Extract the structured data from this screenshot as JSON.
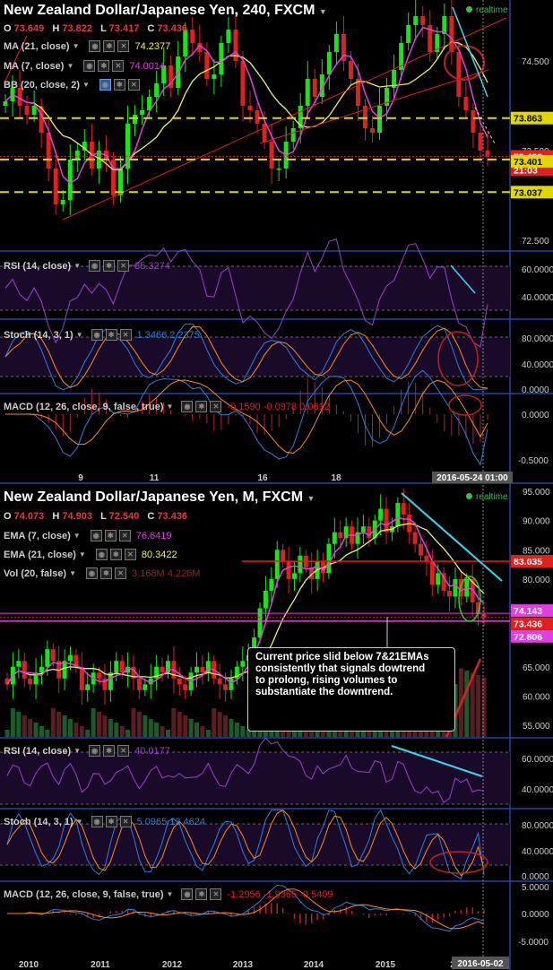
{
  "colors": {
    "bull": "#16e516",
    "bear": "#e01f1f",
    "ma21": "#f0f060",
    "ma7": "#e040e0",
    "bb": "#c8c850",
    "rsi": "#9b3fd0",
    "stoch_k": "#2a7fe0",
    "stoch_d": "#ff8a1c",
    "macd": "#2a7fe0",
    "signal": "#ff8a1c",
    "grid": "#222",
    "axis_sep": "#2244aa",
    "cyan": "#3ad7f0",
    "price_red": "#e01f1f",
    "dash_yellow": "#e0d800"
  },
  "realtime_label": "realtime",
  "top": {
    "title": "New Zealand Dollar/Japanese Yen, 240, FXCM",
    "ohlc": [
      {
        "k": "O",
        "v": "73.649"
      },
      {
        "k": "H",
        "v": "73.822"
      },
      {
        "k": "L",
        "v": "73.417"
      },
      {
        "k": "C",
        "v": "73.436"
      }
    ],
    "indicators": [
      {
        "label": "MA (21, close)",
        "value": "74.2377",
        "color": "#f0f060"
      },
      {
        "label": "MA (7, close)",
        "value": "74.0014",
        "color": "#e040e0"
      },
      {
        "label": "BB (20, close, 2)",
        "value": "",
        "color": "#c8c850"
      }
    ],
    "price_labels": [
      "74.500",
      "73.500",
      "72.500"
    ],
    "tags": [
      {
        "text": "73.863"
      },
      {
        "text": "73.436"
      },
      {
        "text": "21:03"
      },
      {
        "text": "73.401"
      },
      {
        "text": "73.037"
      }
    ],
    "rsi": {
      "label": "RSI (14, close)",
      "value": "35.3274",
      "ticks": [
        "60.0000",
        "40.0000"
      ]
    },
    "stoch": {
      "label": "Stoch (14, 3, 1)",
      "values": "1.3466 2.2375",
      "ticks": [
        "80.0000",
        "40.0000",
        "0.0000"
      ]
    },
    "macd": {
      "label": "MACD (12, 26, close, 9, false, true)",
      "values": "-0.1590 -0.0978 0.0612",
      "ticks": [
        "0.0000",
        "-0.5000"
      ]
    },
    "x_labels": [
      "9",
      "11",
      "16",
      "18"
    ],
    "x_current": "2016-05-24 01:00"
  },
  "bottom": {
    "title": "New Zealand Dollar/Japanese Yen, M, FXCM",
    "ohlc": [
      {
        "k": "O",
        "v": "74.073"
      },
      {
        "k": "H",
        "v": "74.903"
      },
      {
        "k": "L",
        "v": "72.540"
      },
      {
        "k": "C",
        "v": "73.436"
      }
    ],
    "indicators": [
      {
        "label": "EMA (7, close)",
        "value": "76.6419",
        "color": "#e040e0"
      },
      {
        "label": "EMA (21, close)",
        "value": "80.3422",
        "color": "#f0f060"
      },
      {
        "label": "Vol (20, false)",
        "value": "3.168M 4.226M",
        "color": "#8a2a2a"
      }
    ],
    "price_labels": [
      "95.000",
      "90.000",
      "85.000",
      "80.000",
      "75.000",
      "65.000",
      "60.000",
      "55.000"
    ],
    "tags": [
      {
        "text": "83.035"
      },
      {
        "text": "74.143"
      },
      {
        "text": "73.436"
      },
      {
        "text": "72.806"
      }
    ],
    "annotation": "Current price slid below 7&21EMAs consistently that signals dowtrend to prolong, rising volumes to substantiate the downtrend.",
    "rsi": {
      "label": "RSI (14, close)",
      "value": "40.0177",
      "ticks": [
        "60.0000",
        "40.0000"
      ]
    },
    "stoch": {
      "label": "Stoch (14, 3, 1)",
      "values": "5.0965 13.4624",
      "ticks": [
        "80.0000",
        "40.0000",
        "0.0000"
      ]
    },
    "macd": {
      "label": "MACD (12, 26, close, 9, false, true)",
      "values": "-1.2956 -1.9365 -0.5409",
      "ticks": [
        "5.0000",
        "0.0000",
        "-5.0000"
      ]
    },
    "x_labels": [
      "2010",
      "2011",
      "2012",
      "2013",
      "2014",
      "2015",
      "2"
    ],
    "x_current": "2016-05-02"
  },
  "chart_data": [
    {
      "type": "candlestick",
      "title": "New Zealand Dollar/Japanese Yen, 240, FXCM",
      "xlabel": "",
      "ylabel": "",
      "x_ticks": [
        "9",
        "11",
        "16",
        "18"
      ],
      "ylim": [
        72.4,
        75.0
      ],
      "series": [
        {
          "name": "MA (21, close)",
          "last": 74.2377
        },
        {
          "name": "MA (7, close)",
          "last": 74.0014
        }
      ],
      "close": [
        74.05,
        74.2,
        74.0,
        73.9,
        74.0,
        73.7,
        73.3,
        72.9,
        72.95,
        73.4,
        73.5,
        73.6,
        73.3,
        73.5,
        73.4,
        73.0,
        73.3,
        73.8,
        73.9,
        73.95,
        74.1,
        74.25,
        74.45,
        74.2,
        74.55,
        74.85,
        74.7,
        74.6,
        74.3,
        74.35,
        74.7,
        74.85,
        74.5,
        74.0,
        73.95,
        73.8,
        73.6,
        73.3,
        73.3,
        73.6,
        73.75,
        74.0,
        74.3,
        74.1,
        74.35,
        74.6,
        74.8,
        74.5,
        74.3,
        74.0,
        73.75,
        73.7,
        74.0,
        74.2,
        74.4,
        74.7,
        74.9,
        75.0,
        74.9,
        74.6,
        74.8,
        75.0,
        74.6,
        74.1,
        73.95,
        73.7,
        73.5,
        73.436
      ],
      "levels": [
        73.863,
        73.436,
        73.401,
        73.037
      ],
      "rsi_last": 35.3274,
      "stoch_last": [
        1.3466,
        2.2375
      ],
      "macd_last": [
        -0.159,
        -0.0978,
        0.0612
      ]
    },
    {
      "type": "candlestick",
      "title": "New Zealand Dollar/Japanese Yen, M, FXCM",
      "xlabel": "",
      "ylabel": "",
      "x_ticks": [
        "2010",
        "2011",
        "2012",
        "2013",
        "2014",
        "2015",
        "2"
      ],
      "ylim": [
        53.0,
        96.0
      ],
      "series": [
        {
          "name": "EMA (7, close)",
          "last": 76.6419
        },
        {
          "name": "EMA (21, close)",
          "last": 80.3422
        },
        {
          "name": "Vol (20, false)",
          "last": "3.168M 4.226M"
        }
      ],
      "close": [
        62,
        65,
        66,
        63,
        62,
        64,
        65,
        68,
        66,
        63,
        66,
        67,
        65,
        61,
        62,
        64,
        63,
        61,
        64,
        66,
        64,
        65,
        63,
        61,
        62,
        63,
        65,
        64,
        66,
        63,
        62,
        61,
        64,
        65,
        64,
        66,
        63,
        62,
        61,
        63,
        65,
        66,
        67,
        70,
        75,
        78,
        80,
        85,
        83,
        80,
        81,
        84,
        82,
        80,
        83,
        81,
        86,
        88,
        87,
        89,
        86,
        88,
        89,
        87,
        90,
        92,
        88,
        89,
        93,
        91,
        88,
        86,
        84,
        83,
        79,
        81,
        78,
        77,
        80,
        77,
        80,
        76,
        74,
        73.436
      ],
      "levels": [
        83.035,
        74.143,
        73.436,
        72.806
      ],
      "rsi_last": 40.0177,
      "stoch_last": [
        5.0965,
        13.4624
      ],
      "macd_last": [
        -1.2956,
        -1.9365,
        -0.5409
      ]
    }
  ]
}
